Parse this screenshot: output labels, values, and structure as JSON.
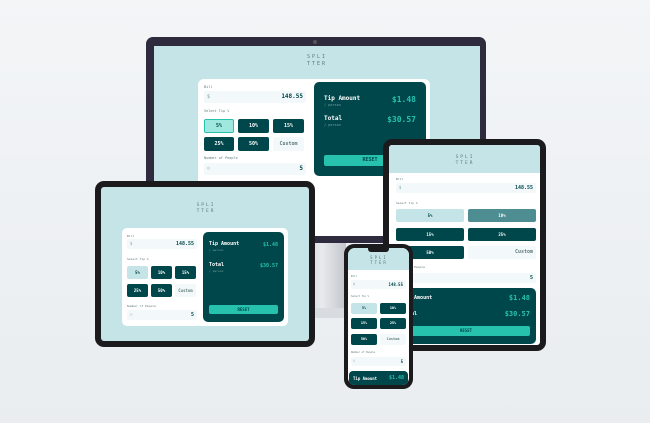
{
  "app": {
    "title_line1": "SPLI",
    "title_line2": "TTER"
  },
  "bill": {
    "label": "Bill",
    "value": "148.55",
    "icon": "dollar-icon"
  },
  "tip": {
    "label": "Select Tip %",
    "options": [
      "5%",
      "10%",
      "15%",
      "25%",
      "50%"
    ],
    "custom_placeholder": "Custom",
    "selected": "5%"
  },
  "people": {
    "label": "Number of People",
    "value": "5",
    "icon": "person-icon"
  },
  "results": {
    "tip_amount_label": "Tip Amount",
    "tip_amount_sub": "/ person",
    "tip_amount_value": "$1.48",
    "total_label": "Total",
    "total_sub": "/ person",
    "total_value": "$30.57",
    "reset_label": "RESET"
  },
  "colors": {
    "accent": "#26c2ae",
    "dark": "#00474b",
    "screen": "#c5e4e7"
  }
}
